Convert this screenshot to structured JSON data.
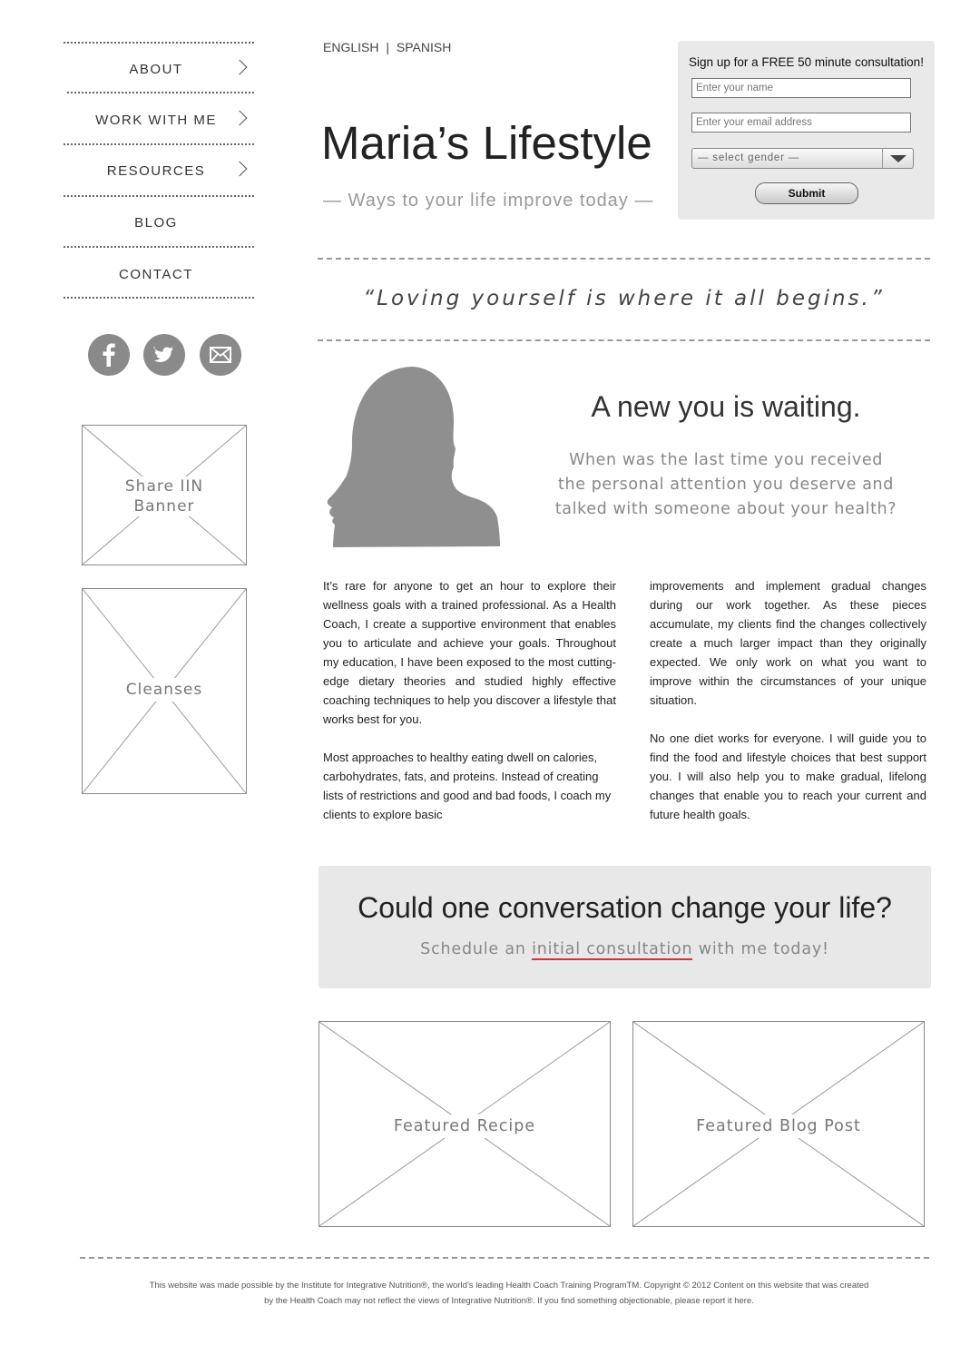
{
  "nav": {
    "items": [
      {
        "label": "ABOUT",
        "has_chevron": true
      },
      {
        "label": "WORK WITH ME",
        "has_chevron": true
      },
      {
        "label": "RESOURCES",
        "has_chevron": true
      },
      {
        "label": "BLOG",
        "has_chevron": false
      },
      {
        "label": "CONTACT",
        "has_chevron": false
      }
    ]
  },
  "social": [
    "facebook-icon",
    "twitter-icon",
    "email-icon"
  ],
  "sidebar_placeholders": {
    "share_banner": "Share IIN\nBanner",
    "cleanses": "Cleanses"
  },
  "header": {
    "lang_english": "ENGLISH",
    "lang_separator": "|",
    "lang_spanish": "SPANISH",
    "title": "Maria’s Lifestyle",
    "tagline": "— Ways to your life improve today —"
  },
  "signup": {
    "title": "Sign up for a FREE 50 minute consultation!",
    "name_placeholder": "Enter your name",
    "email_placeholder": "Enter your email address",
    "gender_selected": "—  select gender  —",
    "submit_label": "Submit"
  },
  "quote": "“Loving yourself is where it all begins.”",
  "intro": {
    "heading": "A new you is waiting.",
    "subheading": "When was the last time you received the personal attention you deserve and talked with someone about your health?"
  },
  "body": {
    "left_p1": "It’s rare for anyone to get an hour to explore their wellness goals with a trained professional. As a Health Coach, I create a supportive environment that enables you to articulate and achieve your goals. Throughout my education, I have been exposed to the most cutting-edge dietary theories and studied highly effective coaching techniques to help you discover a lifestyle that works best for you.",
    "left_p2": "Most approaches to healthy eating dwell on calories, carbohydrates, fats, and proteins. Instead of creating lists of restrictions and good and bad foods, I coach my clients to explore basic",
    "right_p1": "improvements and implement gradual changes during our work together. As these pieces accumulate, my clients find the changes collectively create a much larger impact than they originally expected. We only work on what you want to improve within the circumstances of your unique situation.",
    "right_p2": "No one diet works for everyone. I will guide you to find the food and lifestyle choices that best support you. I will also help you to make gradual, lifelong changes that enable you to reach your current and future health goals."
  },
  "cta": {
    "heading": "Could one conversation change your life?",
    "sub_before": "Schedule an ",
    "sub_link": "initial consultation",
    "sub_after": " with me today!",
    "link_underline_color": "#c9363b"
  },
  "featured": {
    "recipe": "Featured Recipe",
    "blog_post": "Featured Blog Post"
  },
  "footer": {
    "line1": "This website was made possible by the Institute for Integrative Nutrition®, the world’s leading Health Coach Training ProgramTM. Copyright © 2012 Content on this website that was created",
    "line2": "by the Health Coach may not reflect the views of Integrative Nutrition®. If you find something objectionable, please report it here."
  }
}
